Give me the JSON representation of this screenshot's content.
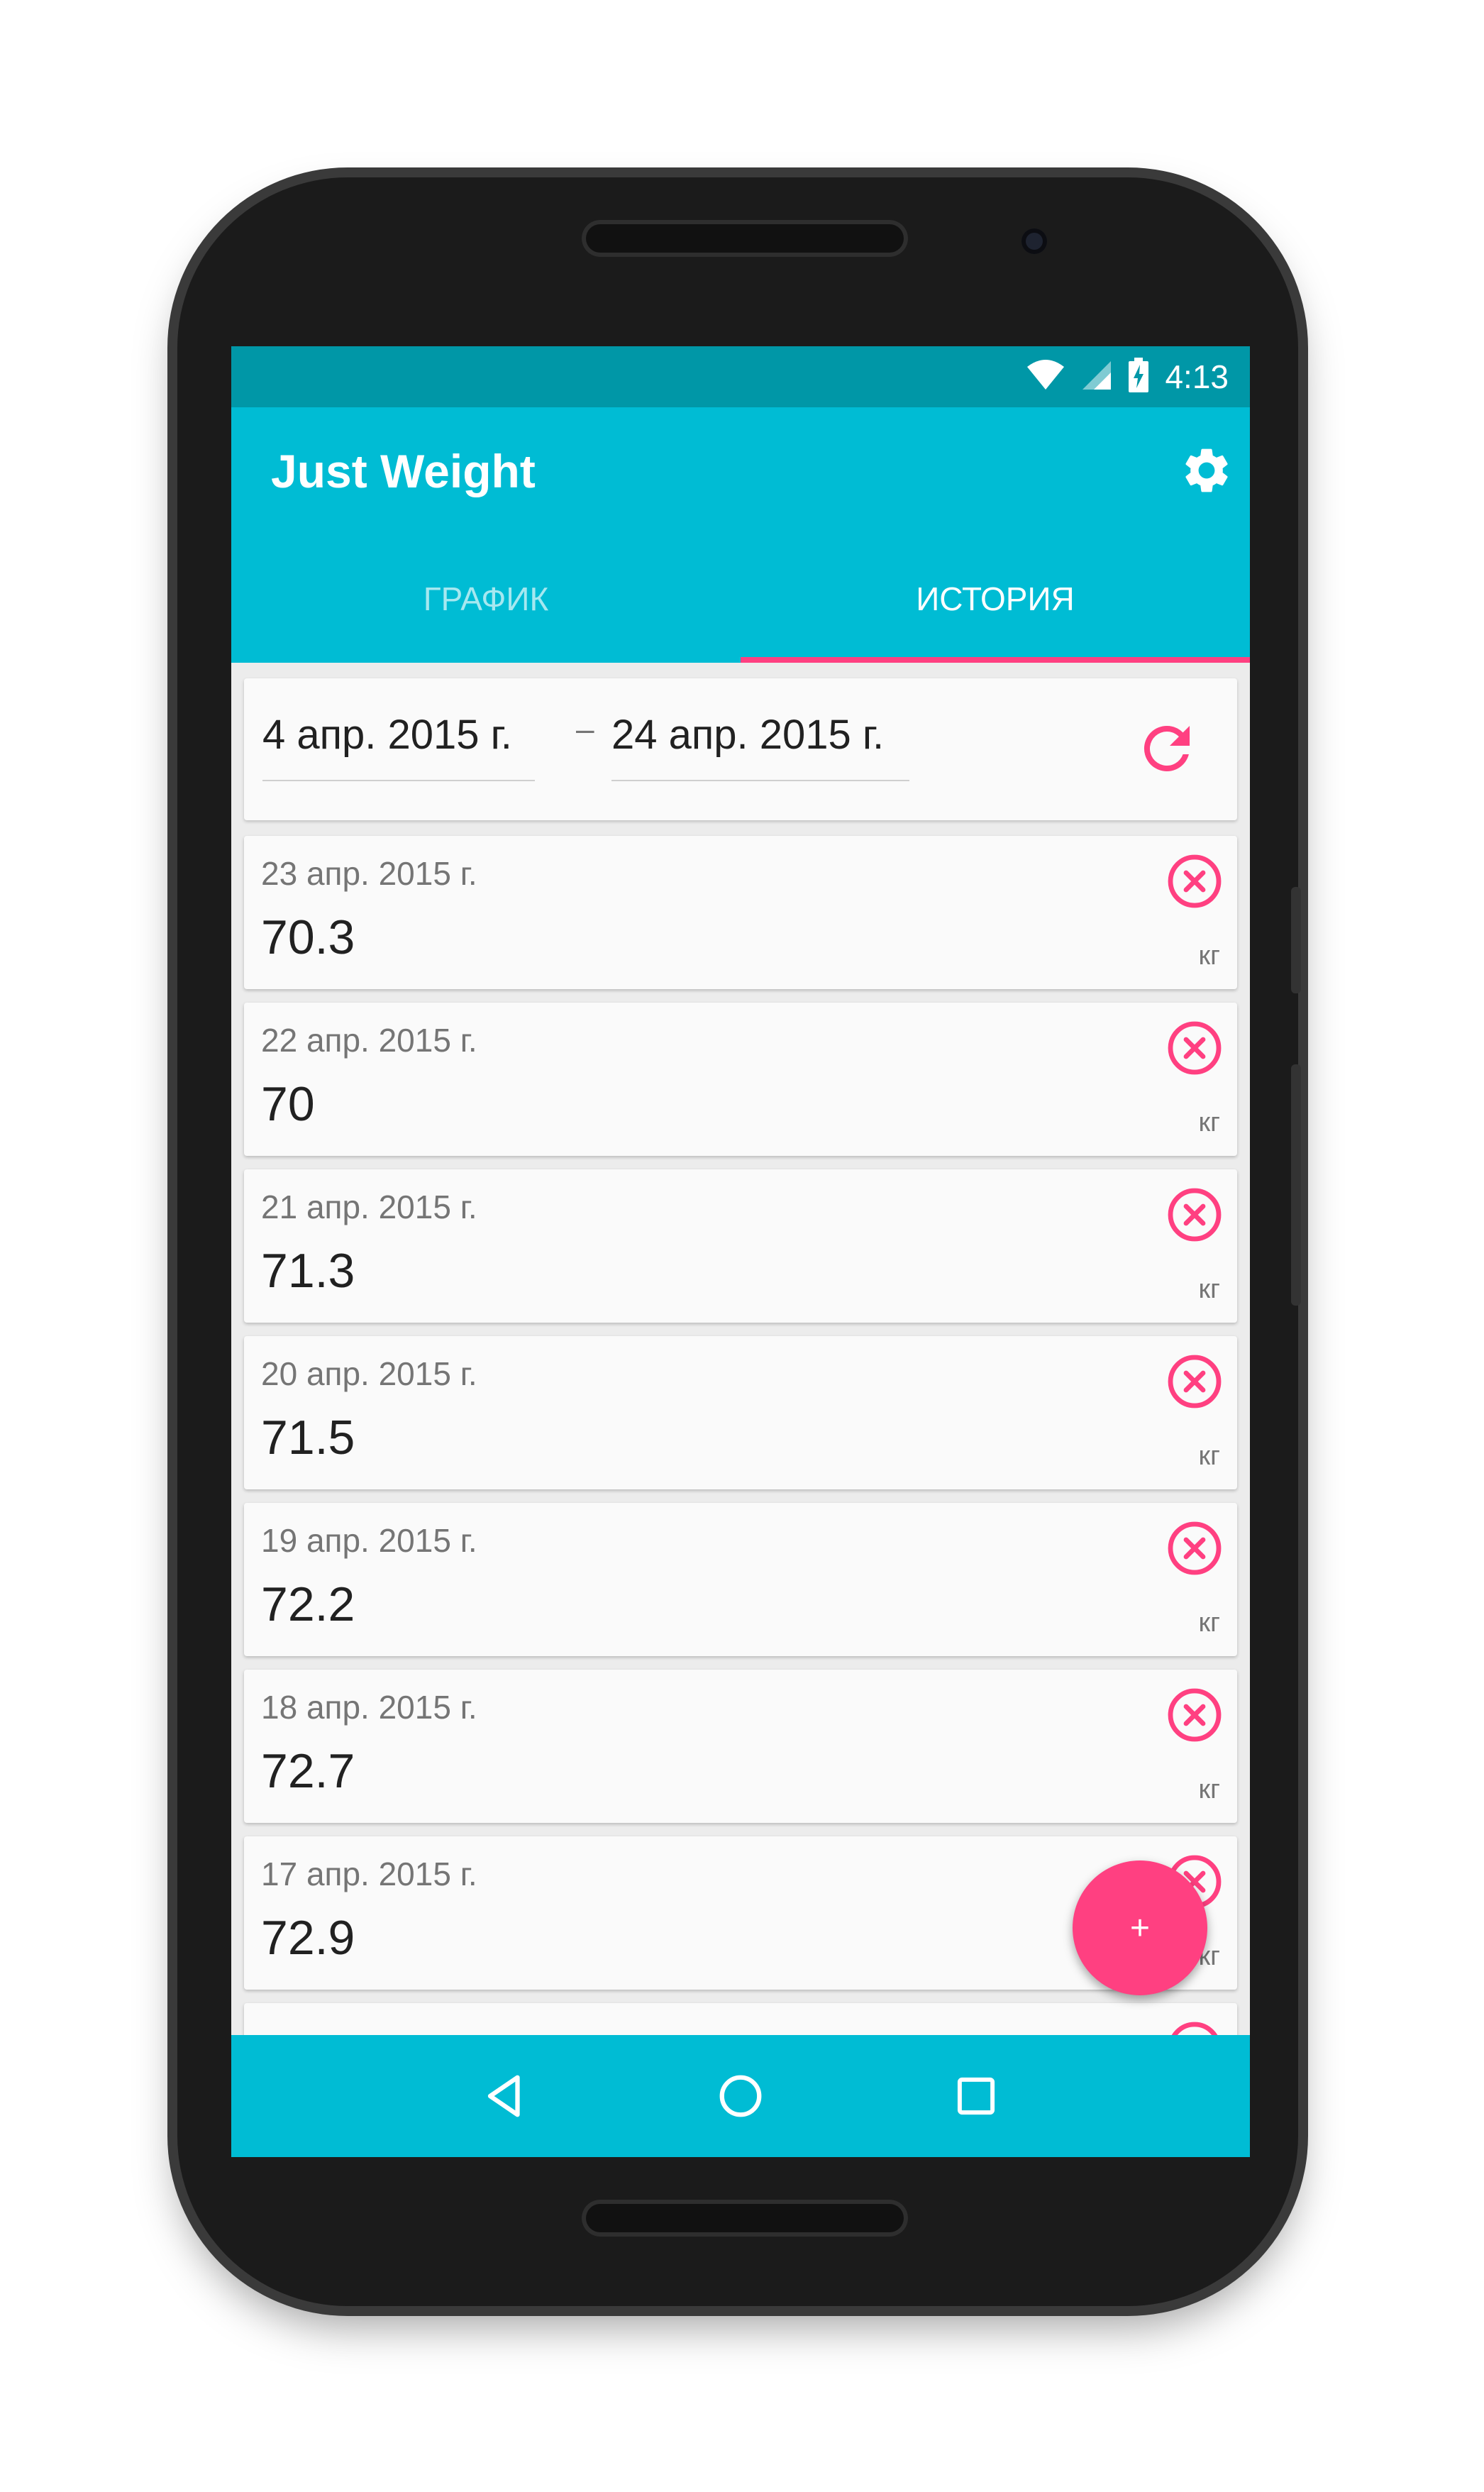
{
  "status_bar": {
    "time": "4:13",
    "icons": [
      "wifi-icon",
      "signal-icon",
      "battery-charging-icon"
    ]
  },
  "app": {
    "title": "Just Weight",
    "settings_icon": "gear-icon"
  },
  "tabs": [
    {
      "label": "ГРАФИК",
      "active": false
    },
    {
      "label": "ИСТОРИЯ",
      "active": true
    }
  ],
  "date_range": {
    "from": "4 апр. 2015 г.",
    "separator": "–",
    "to": "24 апр. 2015 г.",
    "refresh_icon": "refresh-icon"
  },
  "entries": [
    {
      "date": "23 апр. 2015 г.",
      "weight": "70.3",
      "unit": "кг"
    },
    {
      "date": "22 апр. 2015 г.",
      "weight": "70",
      "unit": "кг"
    },
    {
      "date": "21 апр. 2015 г.",
      "weight": "71.3",
      "unit": "кг"
    },
    {
      "date": "20 апр. 2015 г.",
      "weight": "71.5",
      "unit": "кг"
    },
    {
      "date": "19 апр. 2015 г.",
      "weight": "72.2",
      "unit": "кг"
    },
    {
      "date": "18 апр. 2015 г.",
      "weight": "72.7",
      "unit": "кг"
    },
    {
      "date": "17 апр. 2015 г.",
      "weight": "72.9",
      "unit": "кг"
    }
  ],
  "fab": {
    "label": "+"
  },
  "nav": [
    "back-icon",
    "home-icon",
    "recents-icon"
  ],
  "colors": {
    "primary": "#00bcd4",
    "primary_dark": "#0097a7",
    "accent": "#ff4081"
  }
}
